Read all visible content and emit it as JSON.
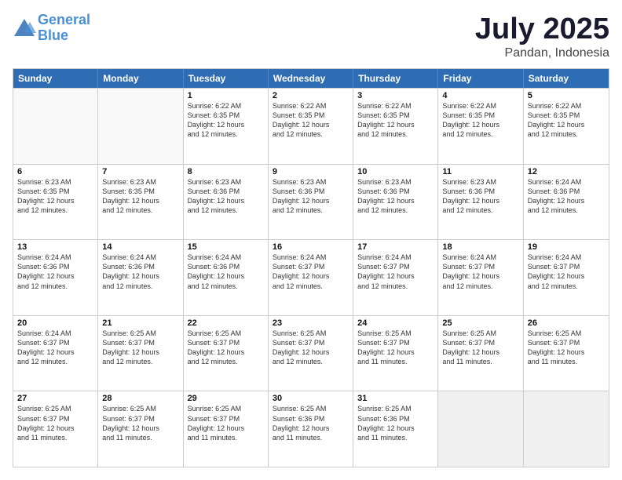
{
  "header": {
    "logo_line1": "General",
    "logo_line2": "Blue",
    "month": "July 2025",
    "location": "Pandan, Indonesia"
  },
  "days_of_week": [
    "Sunday",
    "Monday",
    "Tuesday",
    "Wednesday",
    "Thursday",
    "Friday",
    "Saturday"
  ],
  "weeks": [
    [
      {
        "day": "",
        "info": "",
        "empty": true
      },
      {
        "day": "",
        "info": "",
        "empty": true
      },
      {
        "day": "1",
        "info": "Sunrise: 6:22 AM\nSunset: 6:35 PM\nDaylight: 12 hours\nand 12 minutes."
      },
      {
        "day": "2",
        "info": "Sunrise: 6:22 AM\nSunset: 6:35 PM\nDaylight: 12 hours\nand 12 minutes."
      },
      {
        "day": "3",
        "info": "Sunrise: 6:22 AM\nSunset: 6:35 PM\nDaylight: 12 hours\nand 12 minutes."
      },
      {
        "day": "4",
        "info": "Sunrise: 6:22 AM\nSunset: 6:35 PM\nDaylight: 12 hours\nand 12 minutes."
      },
      {
        "day": "5",
        "info": "Sunrise: 6:22 AM\nSunset: 6:35 PM\nDaylight: 12 hours\nand 12 minutes."
      }
    ],
    [
      {
        "day": "6",
        "info": "Sunrise: 6:23 AM\nSunset: 6:35 PM\nDaylight: 12 hours\nand 12 minutes."
      },
      {
        "day": "7",
        "info": "Sunrise: 6:23 AM\nSunset: 6:35 PM\nDaylight: 12 hours\nand 12 minutes."
      },
      {
        "day": "8",
        "info": "Sunrise: 6:23 AM\nSunset: 6:36 PM\nDaylight: 12 hours\nand 12 minutes."
      },
      {
        "day": "9",
        "info": "Sunrise: 6:23 AM\nSunset: 6:36 PM\nDaylight: 12 hours\nand 12 minutes."
      },
      {
        "day": "10",
        "info": "Sunrise: 6:23 AM\nSunset: 6:36 PM\nDaylight: 12 hours\nand 12 minutes."
      },
      {
        "day": "11",
        "info": "Sunrise: 6:23 AM\nSunset: 6:36 PM\nDaylight: 12 hours\nand 12 minutes."
      },
      {
        "day": "12",
        "info": "Sunrise: 6:24 AM\nSunset: 6:36 PM\nDaylight: 12 hours\nand 12 minutes."
      }
    ],
    [
      {
        "day": "13",
        "info": "Sunrise: 6:24 AM\nSunset: 6:36 PM\nDaylight: 12 hours\nand 12 minutes."
      },
      {
        "day": "14",
        "info": "Sunrise: 6:24 AM\nSunset: 6:36 PM\nDaylight: 12 hours\nand 12 minutes."
      },
      {
        "day": "15",
        "info": "Sunrise: 6:24 AM\nSunset: 6:36 PM\nDaylight: 12 hours\nand 12 minutes."
      },
      {
        "day": "16",
        "info": "Sunrise: 6:24 AM\nSunset: 6:37 PM\nDaylight: 12 hours\nand 12 minutes."
      },
      {
        "day": "17",
        "info": "Sunrise: 6:24 AM\nSunset: 6:37 PM\nDaylight: 12 hours\nand 12 minutes."
      },
      {
        "day": "18",
        "info": "Sunrise: 6:24 AM\nSunset: 6:37 PM\nDaylight: 12 hours\nand 12 minutes."
      },
      {
        "day": "19",
        "info": "Sunrise: 6:24 AM\nSunset: 6:37 PM\nDaylight: 12 hours\nand 12 minutes."
      }
    ],
    [
      {
        "day": "20",
        "info": "Sunrise: 6:24 AM\nSunset: 6:37 PM\nDaylight: 12 hours\nand 12 minutes."
      },
      {
        "day": "21",
        "info": "Sunrise: 6:25 AM\nSunset: 6:37 PM\nDaylight: 12 hours\nand 12 minutes."
      },
      {
        "day": "22",
        "info": "Sunrise: 6:25 AM\nSunset: 6:37 PM\nDaylight: 12 hours\nand 12 minutes."
      },
      {
        "day": "23",
        "info": "Sunrise: 6:25 AM\nSunset: 6:37 PM\nDaylight: 12 hours\nand 12 minutes."
      },
      {
        "day": "24",
        "info": "Sunrise: 6:25 AM\nSunset: 6:37 PM\nDaylight: 12 hours\nand 11 minutes."
      },
      {
        "day": "25",
        "info": "Sunrise: 6:25 AM\nSunset: 6:37 PM\nDaylight: 12 hours\nand 11 minutes."
      },
      {
        "day": "26",
        "info": "Sunrise: 6:25 AM\nSunset: 6:37 PM\nDaylight: 12 hours\nand 11 minutes."
      }
    ],
    [
      {
        "day": "27",
        "info": "Sunrise: 6:25 AM\nSunset: 6:37 PM\nDaylight: 12 hours\nand 11 minutes."
      },
      {
        "day": "28",
        "info": "Sunrise: 6:25 AM\nSunset: 6:37 PM\nDaylight: 12 hours\nand 11 minutes."
      },
      {
        "day": "29",
        "info": "Sunrise: 6:25 AM\nSunset: 6:37 PM\nDaylight: 12 hours\nand 11 minutes."
      },
      {
        "day": "30",
        "info": "Sunrise: 6:25 AM\nSunset: 6:36 PM\nDaylight: 12 hours\nand 11 minutes."
      },
      {
        "day": "31",
        "info": "Sunrise: 6:25 AM\nSunset: 6:36 PM\nDaylight: 12 hours\nand 11 minutes."
      },
      {
        "day": "",
        "info": "",
        "empty": true,
        "shaded": true
      },
      {
        "day": "",
        "info": "",
        "empty": true,
        "shaded": true
      }
    ]
  ]
}
